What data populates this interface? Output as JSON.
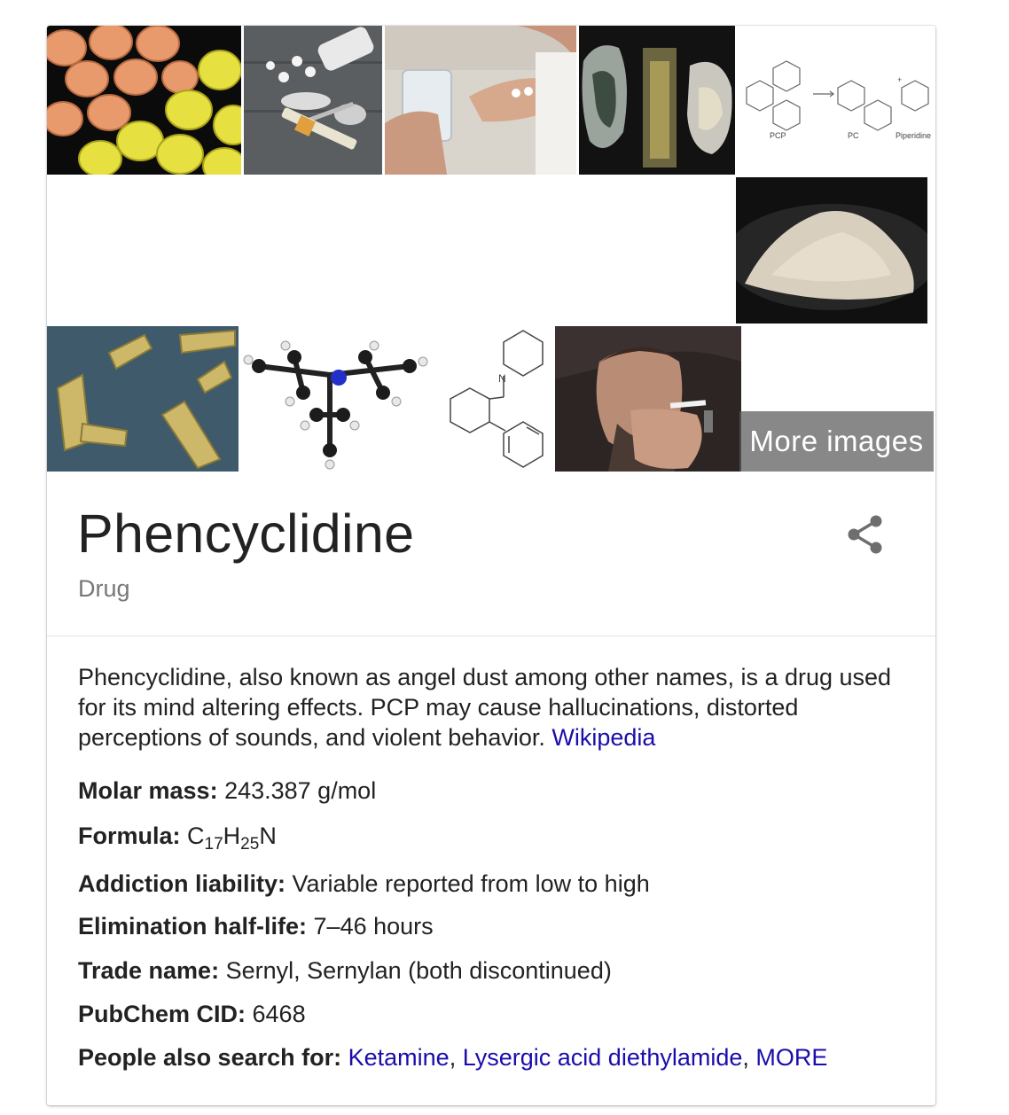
{
  "images": {
    "more_label": "More images",
    "tiles": [
      {
        "name": "orange-yellow-pills"
      },
      {
        "name": "pills-spoon-syringe"
      },
      {
        "name": "hands-with-pills"
      },
      {
        "name": "foil-wrapped-samples"
      },
      {
        "name": "pcp-decomposition-diagram",
        "labels": [
          "PCP",
          "PC",
          "Piperidine"
        ]
      },
      {
        "name": "white-powder-dish"
      },
      {
        "name": "gold-foil-rolls"
      },
      {
        "name": "ball-and-stick-molecule"
      },
      {
        "name": "pcp-structural-formula",
        "atom": "N"
      },
      {
        "name": "man-smoking"
      }
    ]
  },
  "header": {
    "title": "Phencyclidine",
    "subtitle": "Drug"
  },
  "description": {
    "text": "Phencyclidine, also known as angel dust among other names, is a drug used for its mind altering effects. PCP may cause hallucinations, distorted perceptions of sounds, and violent behavior.",
    "source_link": "Wikipedia"
  },
  "facts": {
    "molar_mass": {
      "label": "Molar mass:",
      "value": "243.387 g/mol"
    },
    "formula": {
      "label": "Formula:",
      "c": "C",
      "c_sub": "17",
      "h": "H",
      "h_sub": "25",
      "n": "N"
    },
    "addiction": {
      "label": "Addiction liability:",
      "value": "Variable reported from low to high"
    },
    "half_life": {
      "label": "Elimination half-life:",
      "value": "7–46 hours"
    },
    "trade_name": {
      "label": "Trade name:",
      "value": "Sernyl, Sernylan (both discontinued)"
    },
    "pubchem": {
      "label": "PubChem CID:",
      "value": "6468"
    },
    "people_also": {
      "label": "People also search for:",
      "links": [
        "Ketamine",
        "Lysergic acid diethylamide",
        "MORE"
      ],
      "separator": ","
    }
  },
  "colors": {
    "link": "#1a0dab",
    "title": "#222222",
    "subtitle": "#777777"
  },
  "icons": {
    "share": "share-icon"
  }
}
